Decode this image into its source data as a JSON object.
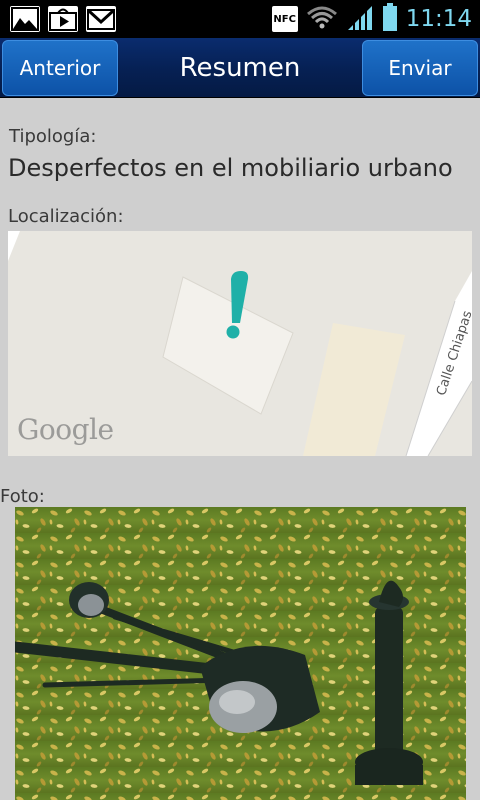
{
  "status_bar": {
    "notification_icons": [
      "gallery-icon",
      "play-store-icon",
      "gmail-icon"
    ],
    "nfc_label": "NFC",
    "time": "11:14"
  },
  "title_bar": {
    "back_label": "Anterior",
    "title": "Resumen",
    "send_label": "Enviar"
  },
  "summary": {
    "type_label": "Tipología:",
    "type_value": "Desperfectos en el mobiliario urbano",
    "location_label": "Localización:",
    "photo_label": "Foto:"
  },
  "map": {
    "street_name": "Calle Chiapas",
    "provider": "Google",
    "marker_color": "#1fb0a8"
  },
  "colors": {
    "titlebar": "#062053",
    "button": "#1565bd",
    "time": "#7fd8f0"
  }
}
